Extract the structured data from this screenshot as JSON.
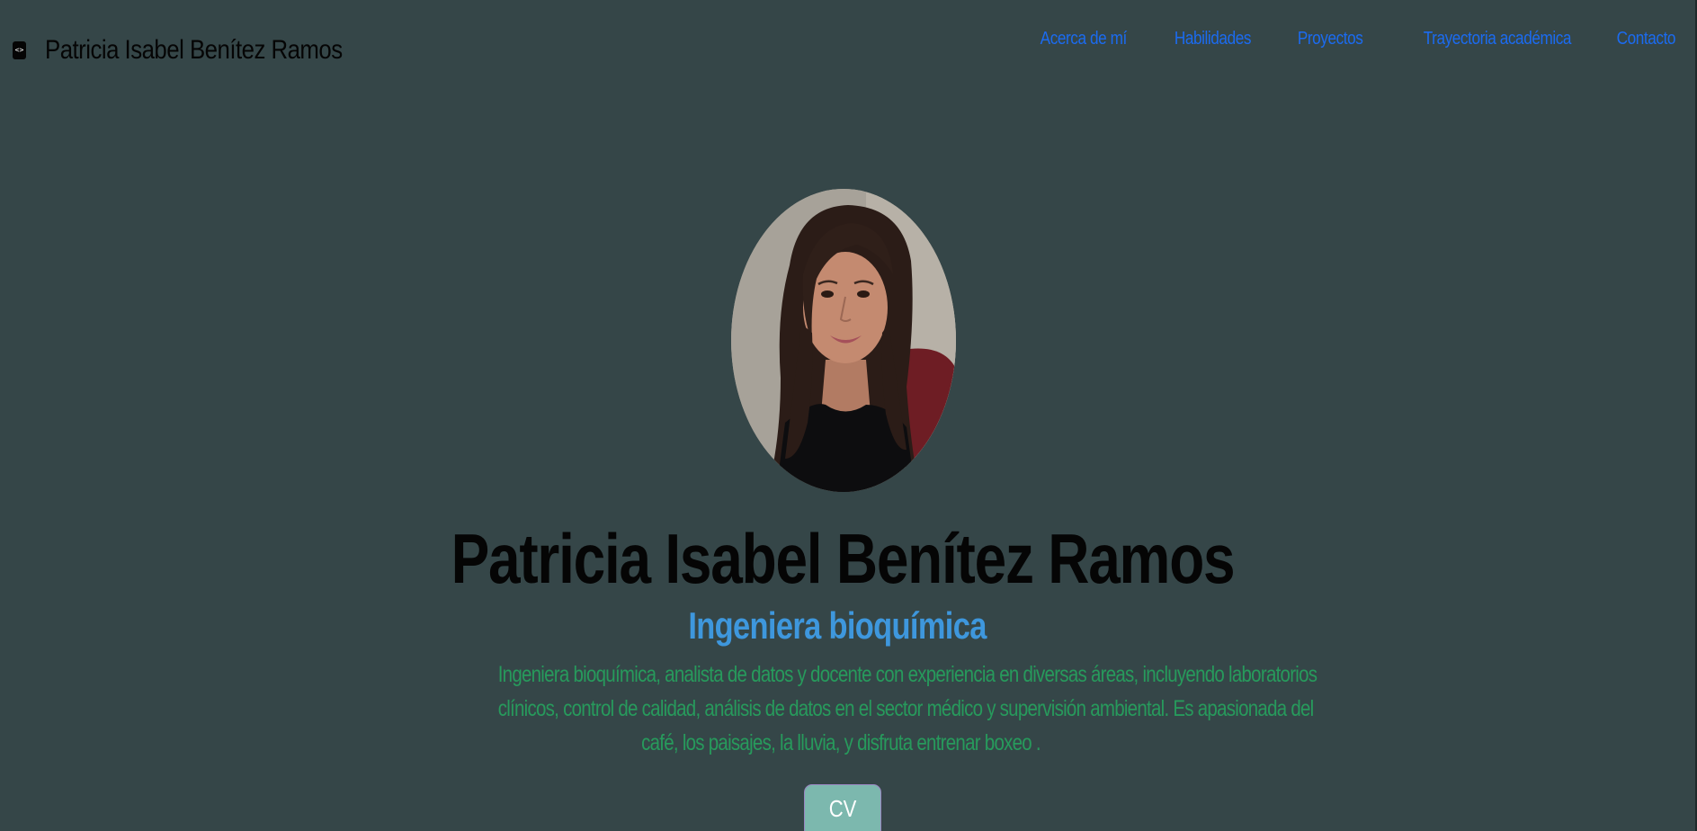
{
  "header": {
    "brand_icon": "code-icon",
    "brand_name": "Patricia Isabel Benítez Ramos",
    "nav": [
      "Acerca de mí",
      "Habilidades",
      "Proyectos",
      "Trayectoria académica",
      "Contacto"
    ]
  },
  "hero": {
    "photo": "profile-photo",
    "name": "Patricia Isabel Benítez Ramos",
    "role": "Ingeniera bioquímica",
    "bio_lines": [
      "Ingeniera bioquímica, analista de datos y docente con experiencia en diversas áreas, incluyendo laboratorios",
      "clínicos, control de calidad, análisis de datos en el sector médico y supervisión ambiental. Es apasionada del",
      "café, los paisajes, la lluvia, y disfruta entrenar boxeo ."
    ],
    "cv_label": "CV"
  },
  "colors": {
    "background": "#354648",
    "nav_link": "#1b6bf0",
    "role": "#3e97dd",
    "bio": "#279a5c",
    "cv_button": "#7cb8ae"
  }
}
